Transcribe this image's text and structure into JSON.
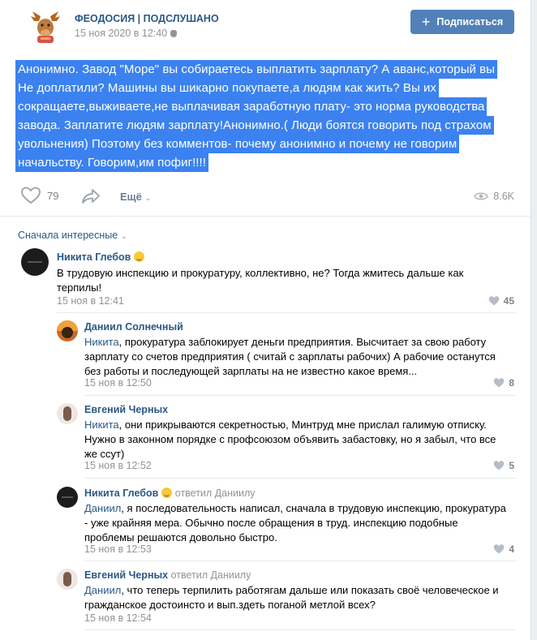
{
  "post": {
    "group_name": "ФЕОДОСИЯ | ПОДСЛУШАНО",
    "date": "15 ноя 2020 в 12:40",
    "subscribe_label": "Подписаться",
    "text_lines": [
      "Анонимно. Завод \"Море\" вы собираетесь выплатить зарплату? А аванс,который вы",
      "Не доплатили? Машины вы шикарно покупаете,а людям как жить? Вы их",
      "сокращаете,выживаете,не выплачивая заработную плату- это норма руководства",
      "завода. Заплатите людям зарплату!Анонимно.( Люди боятся говорить под страхом",
      "увольнения) Поэтому без комментов- почему анонимно и почему не говорим",
      "начальству. Говорим,им пофиг!!!!"
    ],
    "likes": "79",
    "more_label": "Ещё",
    "views": "8.6K"
  },
  "sort_label": "Сначала интересные",
  "comments": [
    {
      "name": "Никита Глебов",
      "reply_to": "",
      "mention": "",
      "text_lines": [
        "В трудовую инспекцию и прокуратуру, коллективно, не? Тогда жмитесь дальше как",
        "терпилы!"
      ],
      "date": "15 ноя в 12:41",
      "likes": "45"
    },
    {
      "name": "Даниил Солнечный",
      "reply_to": "",
      "mention": "Никита",
      "text_lines": [
        ", прокуратура заблокирует деньги предприятия. Высчитает за свою работу",
        "зарплату со счетов предприятия ( считай с зарплаты рабочих) А рабочие останутся",
        "без работы и последующей зарплаты на не известно какое время..."
      ],
      "date": "15 ноя в 12:50",
      "likes": "8"
    },
    {
      "name": "Евгений Черных",
      "reply_to": "",
      "mention": "Никита",
      "text_lines": [
        ", они прикрываются секретностью, Минтруд мне прислал галимую отписку.",
        "Нужно в законном порядке с профсоюзом объявить забастовку, но я забыл, что все",
        "же ссут)"
      ],
      "date": "15 ноя в 12:52",
      "likes": "5"
    },
    {
      "name": "Никита Глебов",
      "reply_to": "ответил Даниилу",
      "mention": "Даниил",
      "text_lines": [
        ", я последовательность написал, сначала в трудовую инспекцию, прокуратура",
        "- уже крайняя мера. Обычно после обращения в труд. инспекцию подобные",
        "проблемы решаются довольно быстро."
      ],
      "date": "15 ноя в 12:53",
      "likes": "4"
    },
    {
      "name": "Евгений Черных",
      "reply_to": "ответил Даниилу",
      "mention": "Даниил",
      "text_lines": [
        ", что теперь терпилить работягам дальше или показать своё человеческое и",
        "гражданское достоинсто и вып.здеть поганой метлой всех?"
      ],
      "date": "15 ноя в 12:54",
      "likes": ""
    }
  ],
  "colors": {
    "link": "#2a5885",
    "button": "#5181b8",
    "selection": "#3b82f0",
    "muted": "#939393"
  }
}
